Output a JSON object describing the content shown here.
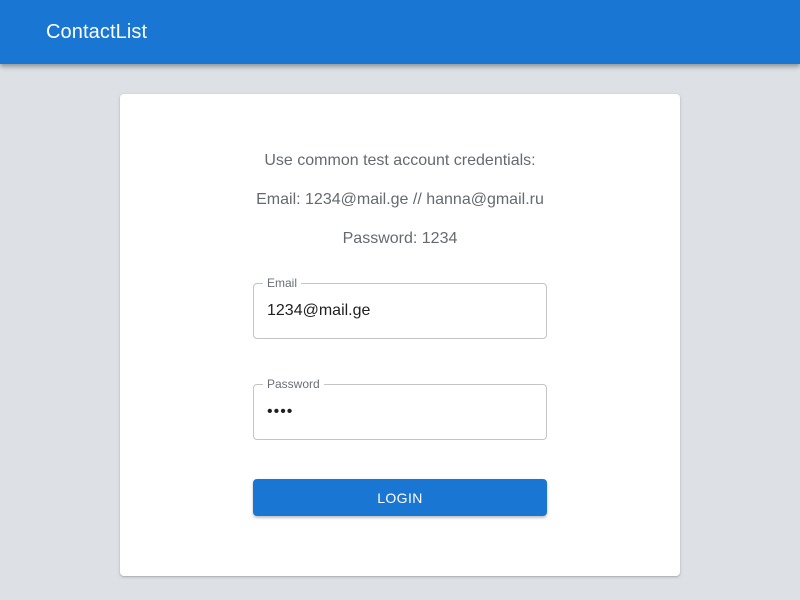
{
  "app_bar": {
    "title": "ContactList",
    "color": "#1976d2"
  },
  "login_card": {
    "info_lines": [
      "Use common test account credentials:",
      "Email: 1234@mail.ge // hanna@gmail.ru",
      "Password: 1234"
    ],
    "email_field": {
      "label": "Email",
      "value": "1234@mail.ge"
    },
    "password_field": {
      "label": "Password",
      "value": "1234"
    },
    "login_button": {
      "label": "LOGIN",
      "color": "#1976d2"
    }
  }
}
